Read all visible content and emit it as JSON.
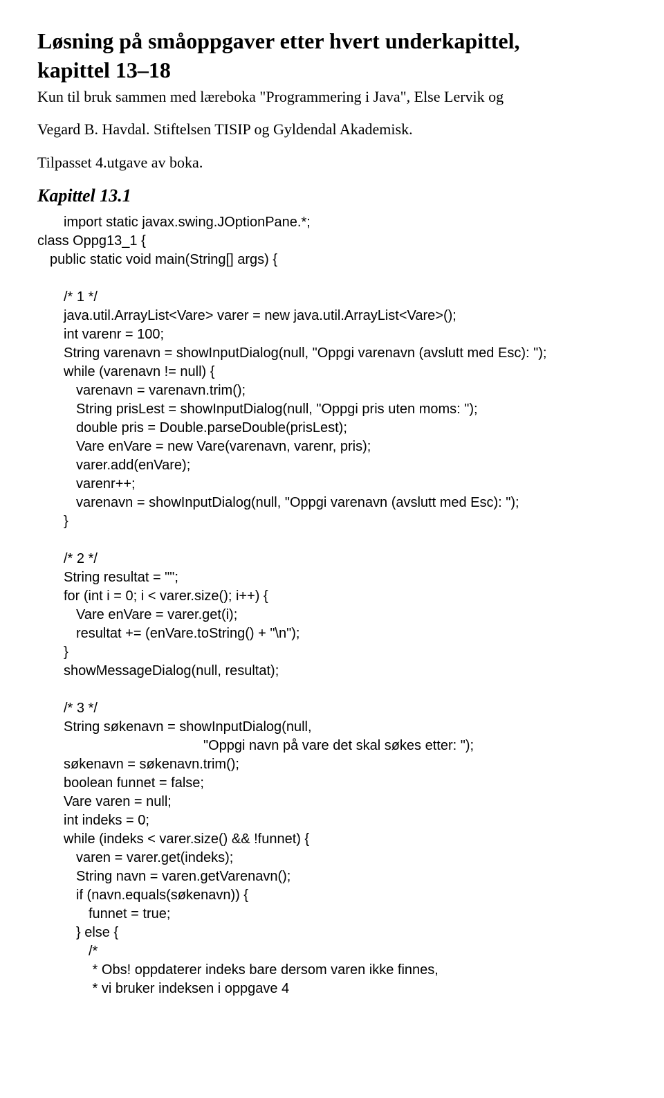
{
  "title_l1": "Løsning på småoppgaver etter hvert underkapittel,",
  "title_l2": "kapittel 13–18",
  "subtitle_l1": "Kun til bruk sammen med læreboka \"Programmering i Java\", Else Lervik og",
  "subtitle_l2": "Vegard B. Havdal. Stiftelsen TISIP og Gyldendal Akademisk.",
  "subtitle_l3": "Tilpasset 4.utgave av boka.",
  "chapter": "Kapittel 13.1",
  "code": {
    "c1": "import static javax.swing.JOptionPane.*;",
    "c2": "class Oppg13_1 {",
    "c3": "public static void main(String[] args) {",
    "c4": "/* 1 */",
    "c5": "java.util.ArrayList<Vare> varer = new java.util.ArrayList<Vare>();",
    "c6": "int varenr = 100;",
    "c7": "String varenavn = showInputDialog(null, \"Oppgi varenavn (avslutt med Esc): \");",
    "c8": "while (varenavn != null) {",
    "c9": "varenavn = varenavn.trim();",
    "c10": "String prisLest = showInputDialog(null, \"Oppgi pris uten moms: \");",
    "c11": "double pris = Double.parseDouble(prisLest);",
    "c12": "Vare enVare = new Vare(varenavn, varenr, pris);",
    "c13": "varer.add(enVare);",
    "c14": "varenr++;",
    "c15": "varenavn = showInputDialog(null, \"Oppgi varenavn (avslutt med Esc): \");",
    "c16": "}",
    "c17": "/* 2 */",
    "c18": "String resultat = \"\";",
    "c19": "for (int i = 0; i < varer.size(); i++) {",
    "c20": "Vare enVare = varer.get(i);",
    "c21": "resultat += (enVare.toString() + \"\\n\");",
    "c22": "}",
    "c23": "showMessageDialog(null, resultat);",
    "c24": "/* 3 */",
    "c25": "String søkenavn = showInputDialog(null,",
    "c26": "\"Oppgi navn på vare det skal søkes etter: \");",
    "c27": "søkenavn = søkenavn.trim();",
    "c28": "boolean funnet = false;",
    "c29": "Vare varen = null;",
    "c30": "int indeks = 0;",
    "c31": "while (indeks < varer.size() && !funnet) {",
    "c32": "varen = varer.get(indeks);",
    "c33": "String navn = varen.getVarenavn();",
    "c34": "if (navn.equals(søkenavn)) {",
    "c35": "funnet = true;",
    "c36": "} else {",
    "c37": "/*",
    "c38": " * Obs! oppdaterer indeks bare dersom varen ikke finnes,",
    "c39": " * vi bruker indeksen i oppgave 4"
  }
}
